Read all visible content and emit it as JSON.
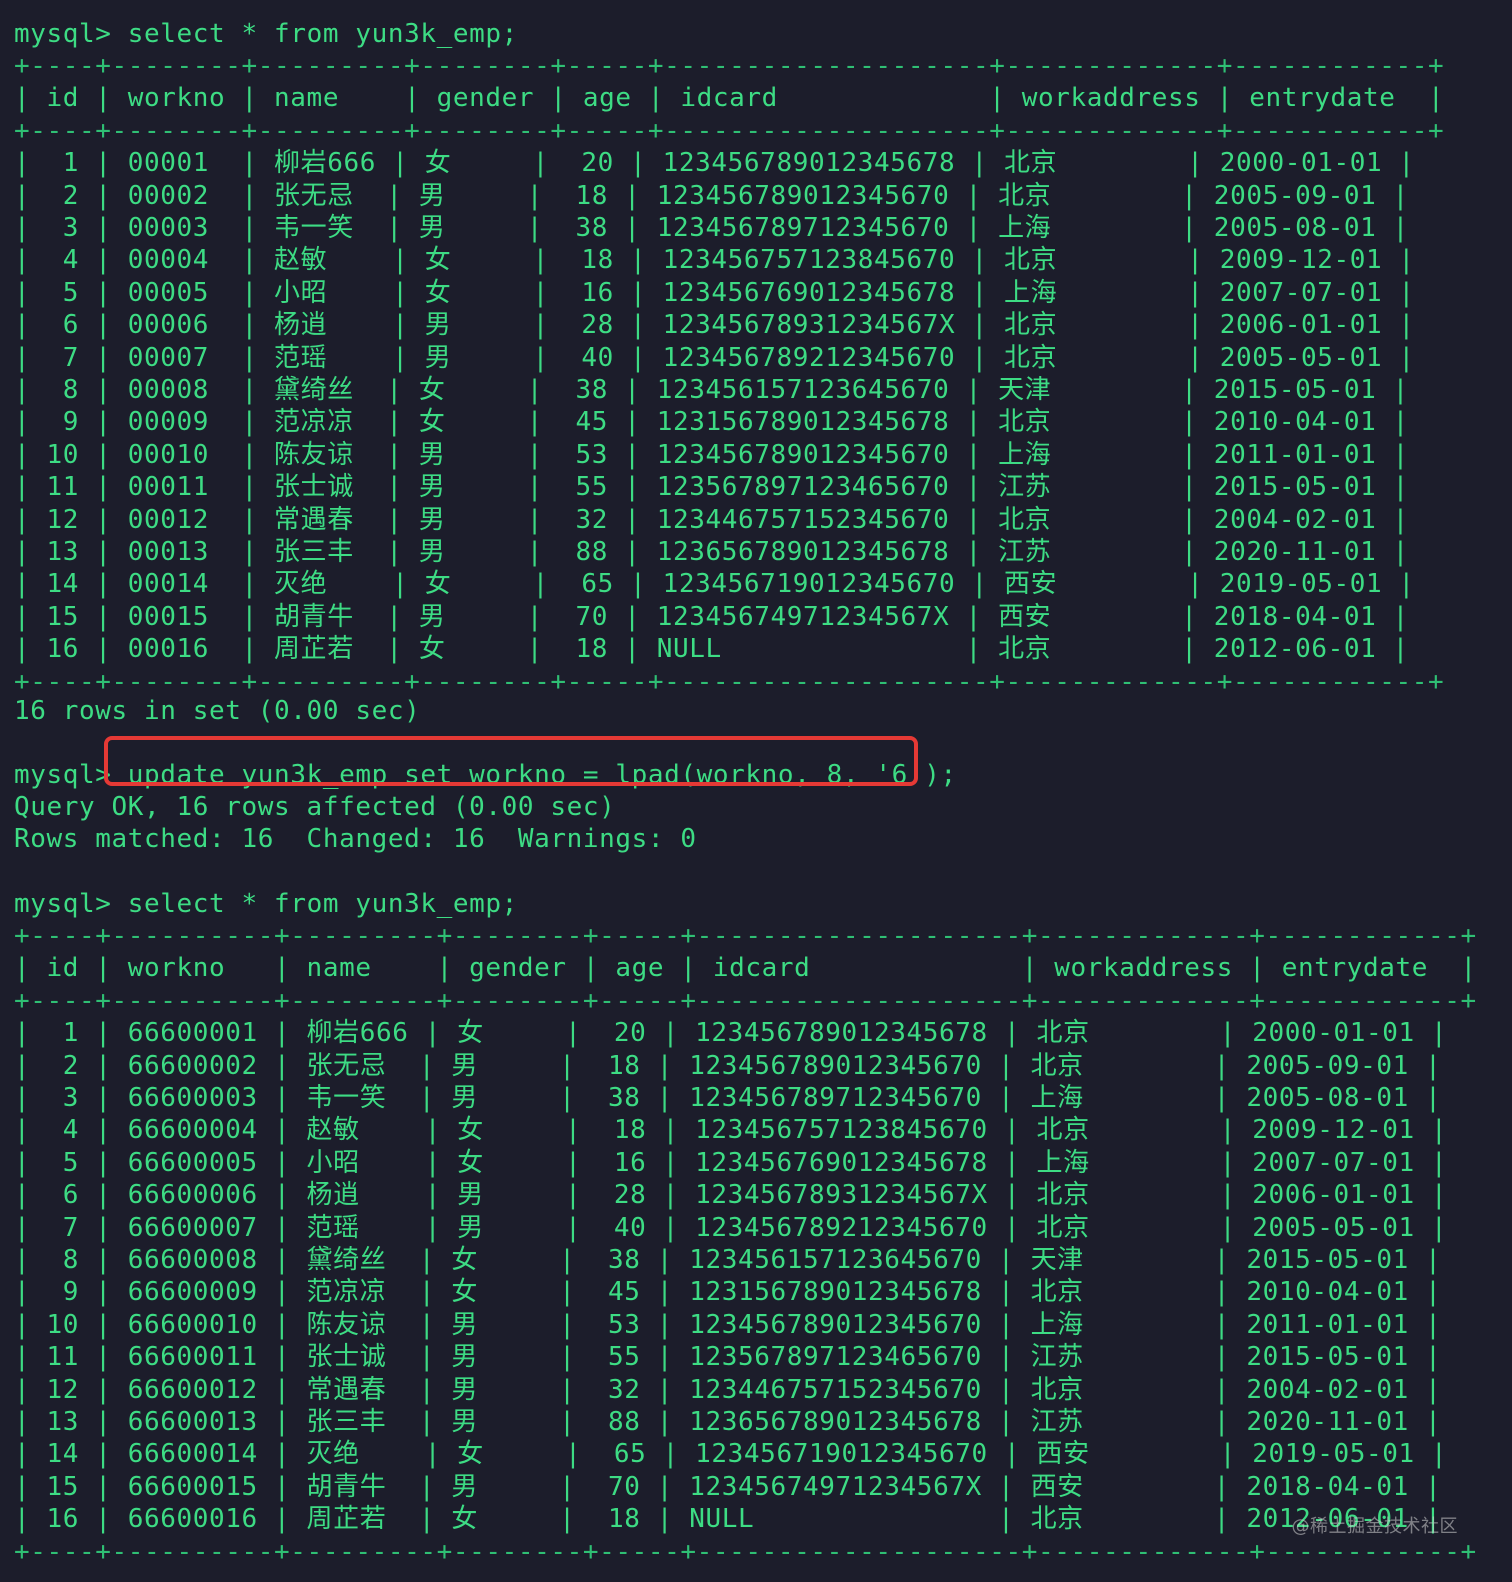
{
  "colors": {
    "background": "#1c1d2b",
    "text": "#3ddc84",
    "highlight_box": "#e53935"
  },
  "terminal": {
    "prompt": "mysql> ",
    "query1": "select * from yun3k_emp;",
    "query2": "update yun3k_emp set workno = lpad(workno, 8, '6');",
    "query3": "select * from yun3k_emp;",
    "result1_footer": "16 rows in set (0.00 sec)",
    "update_result_line1": "Query OK, 16 rows affected (0.00 sec)",
    "update_result_line2": "Rows matched: 16  Changed: 16  Warnings: 0"
  },
  "columns": [
    "id",
    "workno",
    "name",
    "gender",
    "age",
    "idcard",
    "workaddress",
    "entrydate"
  ],
  "table_before": [
    [
      "1",
      "00001",
      "柳岩666",
      "女",
      "20",
      "123456789012345678",
      "北京",
      "2000-01-01"
    ],
    [
      "2",
      "00002",
      "张无忌",
      "男",
      "18",
      "123456789012345670",
      "北京",
      "2005-09-01"
    ],
    [
      "3",
      "00003",
      "韦一笑",
      "男",
      "38",
      "123456789712345670",
      "上海",
      "2005-08-01"
    ],
    [
      "4",
      "00004",
      "赵敏",
      "女",
      "18",
      "123456757123845670",
      "北京",
      "2009-12-01"
    ],
    [
      "5",
      "00005",
      "小昭",
      "女",
      "16",
      "123456769012345678",
      "上海",
      "2007-07-01"
    ],
    [
      "6",
      "00006",
      "杨逍",
      "男",
      "28",
      "12345678931234567X",
      "北京",
      "2006-01-01"
    ],
    [
      "7",
      "00007",
      "范瑶",
      "男",
      "40",
      "123456789212345670",
      "北京",
      "2005-05-01"
    ],
    [
      "8",
      "00008",
      "黛绮丝",
      "女",
      "38",
      "123456157123645670",
      "天津",
      "2015-05-01"
    ],
    [
      "9",
      "00009",
      "范凉凉",
      "女",
      "45",
      "123156789012345678",
      "北京",
      "2010-04-01"
    ],
    [
      "10",
      "00010",
      "陈友谅",
      "男",
      "53",
      "123456789012345670",
      "上海",
      "2011-01-01"
    ],
    [
      "11",
      "00011",
      "张士诚",
      "男",
      "55",
      "123567897123465670",
      "江苏",
      "2015-05-01"
    ],
    [
      "12",
      "00012",
      "常遇春",
      "男",
      "32",
      "123446757152345670",
      "北京",
      "2004-02-01"
    ],
    [
      "13",
      "00013",
      "张三丰",
      "男",
      "88",
      "123656789012345678",
      "江苏",
      "2020-11-01"
    ],
    [
      "14",
      "00014",
      "灭绝",
      "女",
      "65",
      "123456719012345670",
      "西安",
      "2019-05-01"
    ],
    [
      "15",
      "00015",
      "胡青牛",
      "男",
      "70",
      "12345674971234567X",
      "西安",
      "2018-04-01"
    ],
    [
      "16",
      "00016",
      "周芷若",
      "女",
      "18",
      "NULL",
      "北京",
      "2012-06-01"
    ]
  ],
  "table_after": [
    [
      "1",
      "66600001",
      "柳岩666",
      "女",
      "20",
      "123456789012345678",
      "北京",
      "2000-01-01"
    ],
    [
      "2",
      "66600002",
      "张无忌",
      "男",
      "18",
      "123456789012345670",
      "北京",
      "2005-09-01"
    ],
    [
      "3",
      "66600003",
      "韦一笑",
      "男",
      "38",
      "123456789712345670",
      "上海",
      "2005-08-01"
    ],
    [
      "4",
      "66600004",
      "赵敏",
      "女",
      "18",
      "123456757123845670",
      "北京",
      "2009-12-01"
    ],
    [
      "5",
      "66600005",
      "小昭",
      "女",
      "16",
      "123456769012345678",
      "上海",
      "2007-07-01"
    ],
    [
      "6",
      "66600006",
      "杨逍",
      "男",
      "28",
      "12345678931234567X",
      "北京",
      "2006-01-01"
    ],
    [
      "7",
      "66600007",
      "范瑶",
      "男",
      "40",
      "123456789212345670",
      "北京",
      "2005-05-01"
    ],
    [
      "8",
      "66600008",
      "黛绮丝",
      "女",
      "38",
      "123456157123645670",
      "天津",
      "2015-05-01"
    ],
    [
      "9",
      "66600009",
      "范凉凉",
      "女",
      "45",
      "123156789012345678",
      "北京",
      "2010-04-01"
    ],
    [
      "10",
      "66600010",
      "陈友谅",
      "男",
      "53",
      "123456789012345670",
      "上海",
      "2011-01-01"
    ],
    [
      "11",
      "66600011",
      "张士诚",
      "男",
      "55",
      "123567897123465670",
      "江苏",
      "2015-05-01"
    ],
    [
      "12",
      "66600012",
      "常遇春",
      "男",
      "32",
      "123446757152345670",
      "北京",
      "2004-02-01"
    ],
    [
      "13",
      "66600013",
      "张三丰",
      "男",
      "88",
      "123656789012345678",
      "江苏",
      "2020-11-01"
    ],
    [
      "14",
      "66600014",
      "灭绝",
      "女",
      "65",
      "123456719012345670",
      "西安",
      "2019-05-01"
    ],
    [
      "15",
      "66600015",
      "胡青牛",
      "男",
      "70",
      "12345674971234567X",
      "西安",
      "2018-04-01"
    ],
    [
      "16",
      "66600016",
      "周芷若",
      "女",
      "18",
      "NULL",
      "北京",
      "2012-06-01"
    ]
  ],
  "watermark": "@稀土掘金技术社区"
}
